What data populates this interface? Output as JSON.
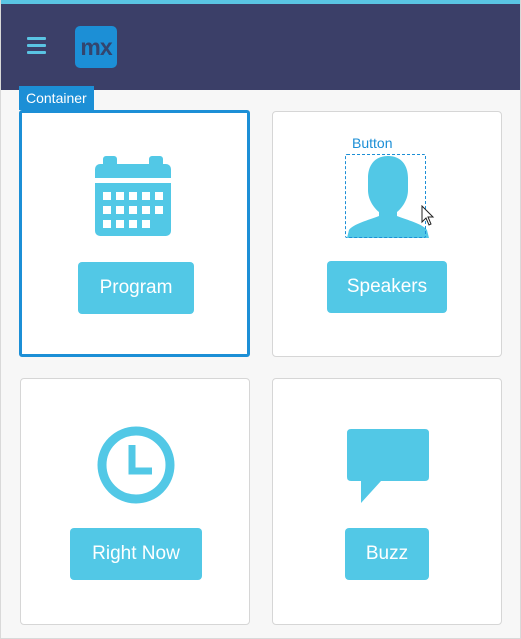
{
  "header": {
    "logo_text": "mx",
    "menu_icon": "hamburger-menu-icon"
  },
  "designer": {
    "container_label": "Container",
    "button_label": "Button"
  },
  "tiles": [
    {
      "label": "Program",
      "icon": "calendar-icon"
    },
    {
      "label": "Speakers",
      "icon": "person-icon"
    },
    {
      "label": "Right Now",
      "icon": "clock-icon"
    },
    {
      "label": "Buzz",
      "icon": "speech-bubble-icon"
    }
  ],
  "colors": {
    "header_bg": "#3b3f68",
    "accent": "#52c8e6",
    "selection": "#1c8fd6"
  }
}
